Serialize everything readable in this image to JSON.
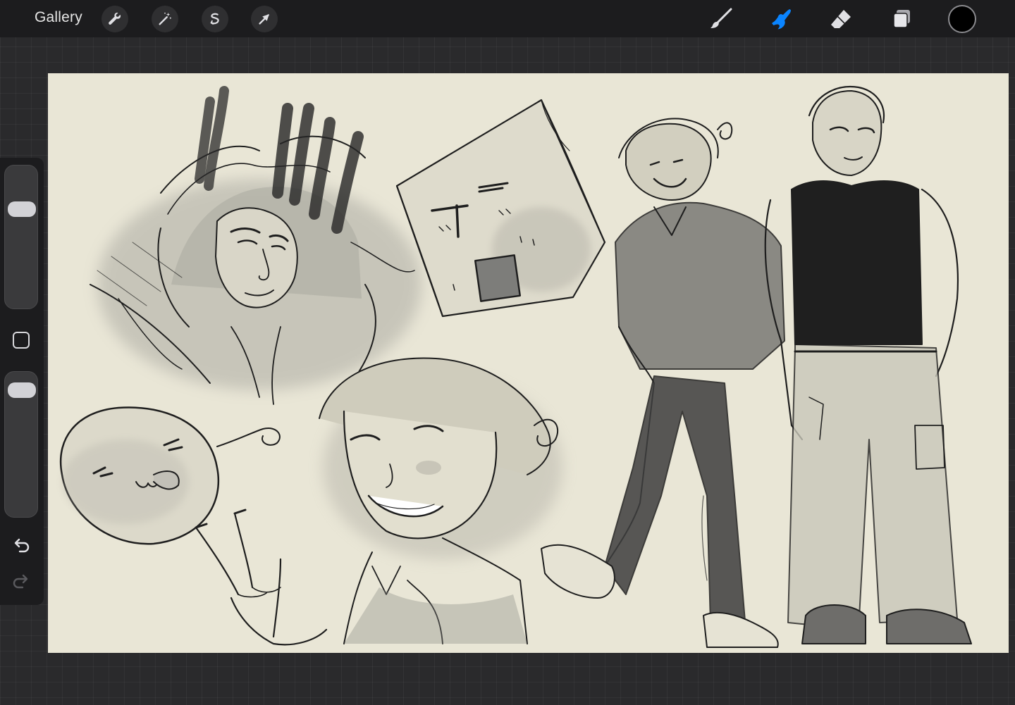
{
  "toolbar": {
    "gallery_label": "Gallery",
    "left_tools": [
      "wrench-icon",
      "magic-wand-icon",
      "selection-icon",
      "transform-arrow-icon"
    ],
    "right_tools": [
      "brush-icon",
      "smudge-icon",
      "eraser-icon",
      "layers-icon"
    ],
    "active_tool": "smudge-icon",
    "active_color": "#0a84ff",
    "current_color": "#000000"
  },
  "sidebar": {
    "brush_size_fraction": 0.27,
    "opacity_fraction": 0.06,
    "undo_enabled": true,
    "redo_enabled": false
  },
  "canvas": {
    "paper_color": "#e9e6d6"
  }
}
